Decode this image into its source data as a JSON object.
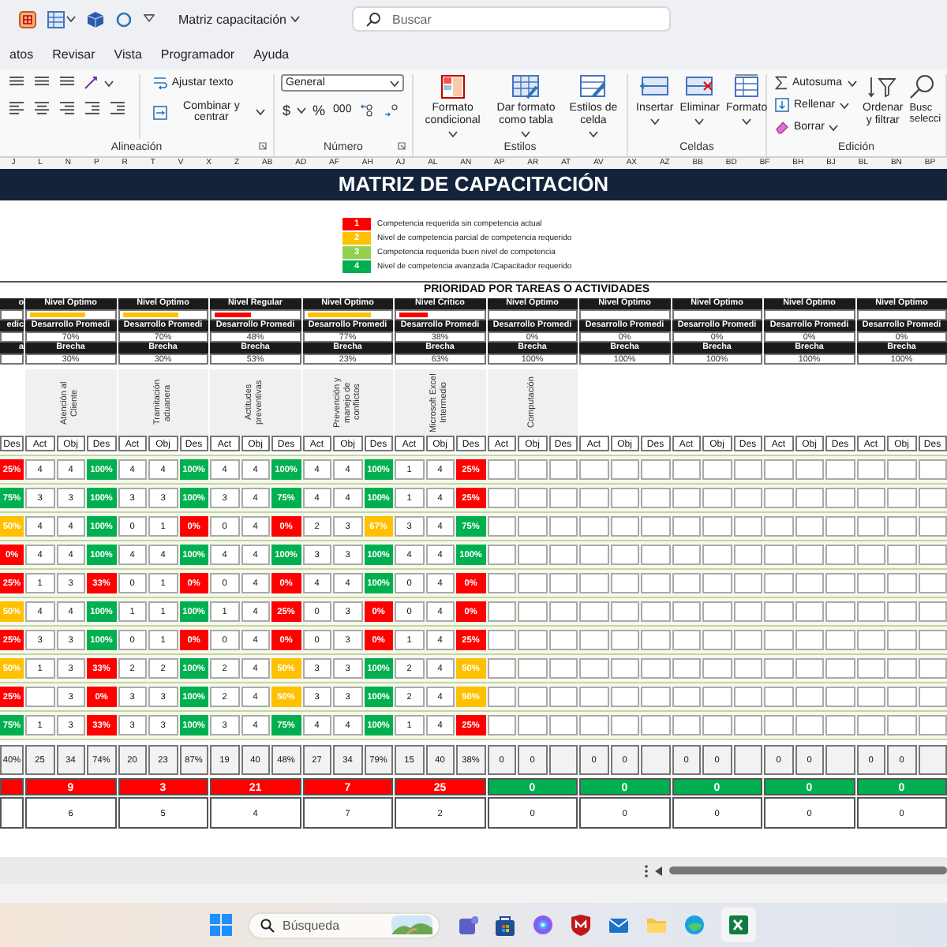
{
  "title_bar": {
    "document_title": "Matriz capacitación",
    "search_placeholder": "Buscar"
  },
  "menu_tabs": [
    "atos",
    "Revisar",
    "Vista",
    "Programador",
    "Ayuda"
  ],
  "ribbon": {
    "alignment": {
      "label": "Alineación",
      "wrap_text": "Ajustar texto",
      "merge_center": "Combinar y centrar"
    },
    "number": {
      "label": "Número",
      "format": "General",
      "currency": "$",
      "percent": "%",
      "thousands": "000"
    },
    "styles": {
      "label": "Estilos",
      "commands": [
        "Formato condicional",
        "Dar formato como tabla",
        "Estilos de celda"
      ]
    },
    "cells": {
      "label": "Celdas",
      "commands": [
        "Insertar",
        "Eliminar",
        "Formato"
      ]
    },
    "editing": {
      "label": "Edición",
      "autosum": "Autosuma",
      "fill": "Rellenar",
      "clear": "Borrar",
      "sort_filter": "Ordenar y filtrar",
      "find_select": "Busc selecci"
    }
  },
  "sheet": {
    "column_letters": [
      "J",
      "L",
      "N",
      "P",
      "R",
      "T",
      "V",
      "X",
      "Z",
      "AB",
      "AD",
      "AF",
      "AH",
      "AJ",
      "AL",
      "AN",
      "AP",
      "AR",
      "AT",
      "AV",
      "AX",
      "AZ",
      "BB",
      "BD",
      "BF",
      "BH",
      "BJ",
      "BL",
      "BN",
      "BP"
    ],
    "title": "MATRIZ DE CAPACITACIÓN",
    "legend": [
      {
        "value": "1",
        "text": "Competencia requerida sin competencia actual",
        "color": "#ff0000"
      },
      {
        "value": "2",
        "text": "Nivel de competencia parcial de competencia requerido",
        "color": "#ffc000"
      },
      {
        "value": "3",
        "text": "Competencia requerida buen nivel de competencia",
        "color": "#92d050"
      },
      {
        "value": "4",
        "text": "Nivel de competencia avanzada /Capacitador requerido",
        "color": "#00b050"
      }
    ],
    "priority_title": "PRIORIDAD POR TAREAS O ACTIVIDADES",
    "lead": {
      "level_name": "o",
      "development_label": "edic",
      "gap_label": "a",
      "column": "Des",
      "total": "40%",
      "priority": {
        "color": "#ff0000"
      }
    },
    "groups": [
      {
        "level_name": "Nivel Optimo",
        "bar": {
          "level": 0.68,
          "color": "#ffc000"
        },
        "development_label": "Desarrollo Promedi",
        "development": "70%",
        "gap_label": "Brecha",
        "gap": "30%",
        "skill": "Atención al Cliente",
        "columns": [
          "Act",
          "Obj",
          "Des"
        ],
        "total": {
          "act": "25",
          "obj": "34",
          "des": "74%"
        },
        "priority": {
          "value": "9",
          "color": "#ff0000"
        },
        "count": "6"
      },
      {
        "level_name": "Nivel Optimo",
        "bar": {
          "level": 0.68,
          "color": "#ffc000"
        },
        "development_label": "Desarrollo Promedi",
        "development": "70%",
        "gap_label": "Brecha",
        "gap": "30%",
        "skill": "Tramitación aduanera",
        "columns": [
          "Act",
          "Obj",
          "Des"
        ],
        "total": {
          "act": "20",
          "obj": "23",
          "des": "87%"
        },
        "priority": {
          "value": "3",
          "color": "#ff0000"
        },
        "count": "5"
      },
      {
        "level_name": "Nivel Regular",
        "bar": {
          "level": 0.45,
          "color": "#ff0000"
        },
        "development_label": "Desarrollo Promedi",
        "development": "48%",
        "gap_label": "Brecha",
        "gap": "53%",
        "skill": "Actitudes preventivas",
        "columns": [
          "Act",
          "Obj",
          "Des"
        ],
        "total": {
          "act": "19",
          "obj": "40",
          "des": "48%"
        },
        "priority": {
          "value": "21",
          "color": "#ff0000"
        },
        "count": "4"
      },
      {
        "level_name": "Nivel Optimo",
        "bar": {
          "level": 0.79,
          "color": "#ffc000"
        },
        "development_label": "Desarrollo Promedi",
        "development": "77%",
        "gap_label": "Brecha",
        "gap": "23%",
        "skill": "Prevención y manejo de conflictos",
        "columns": [
          "Act",
          "Obj",
          "Des"
        ],
        "total": {
          "act": "27",
          "obj": "34",
          "des": "79%"
        },
        "priority": {
          "value": "7",
          "color": "#ff0000"
        },
        "count": "7"
      },
      {
        "level_name": "Nivel Critico",
        "bar": {
          "level": 0.35,
          "color": "#ff0000"
        },
        "development_label": "Desarrollo Promedi",
        "development": "38%",
        "gap_label": "Brecha",
        "gap": "63%",
        "skill": "Microsoft Excel Intermedio",
        "columns": [
          "Act",
          "Obj",
          "Des"
        ],
        "total": {
          "act": "15",
          "obj": "40",
          "des": "38%"
        },
        "priority": {
          "value": "25",
          "color": "#ff0000"
        },
        "count": "2"
      },
      {
        "level_name": "Nivel Optimo",
        "development_label": "Desarrollo Promedi",
        "development": "0%",
        "gap_label": "Brecha",
        "gap": "100%",
        "skill": "Computación",
        "columns": [
          "Act",
          "Obj",
          "Des"
        ],
        "total": {
          "act": "0",
          "obj": "0"
        },
        "priority": {
          "value": "0",
          "color": "#00b050"
        },
        "count": "0"
      },
      {
        "level_name": "Nivel Optimo",
        "development_label": "Desarrollo Promedi",
        "development": "0%",
        "gap_label": "Brecha",
        "gap": "100%",
        "columns": [
          "Act",
          "Obj",
          "Des"
        ],
        "total": {
          "act": "0",
          "obj": "0"
        },
        "priority": {
          "value": "0",
          "color": "#00b050"
        },
        "count": "0"
      },
      {
        "level_name": "Nivel Optimo",
        "development_label": "Desarrollo Promedi",
        "development": "0%",
        "gap_label": "Brecha",
        "gap": "100%",
        "columns": [
          "Act",
          "Obj",
          "Des"
        ],
        "total": {
          "act": "0",
          "obj": "0"
        },
        "priority": {
          "value": "0",
          "color": "#00b050"
        },
        "count": "0"
      },
      {
        "level_name": "Nivel Optimo",
        "development_label": "Desarrollo Promedi",
        "development": "0%",
        "gap_label": "Brecha",
        "gap": "100%",
        "columns": [
          "Act",
          "Obj",
          "Des"
        ],
        "total": {
          "act": "0",
          "obj": "0"
        },
        "priority": {
          "value": "0",
          "color": "#00b050"
        },
        "count": "0"
      },
      {
        "level_name": "Nivel Optimo",
        "development_label": "Desarrollo Promedi",
        "development": "0%",
        "gap_label": "Brecha",
        "gap": "100%",
        "columns": [
          "Act",
          "Obj",
          "Des"
        ],
        "total": {
          "act": "0",
          "obj": "0"
        },
        "priority": {
          "value": "0",
          "color": "#00b050"
        },
        "count": "0"
      }
    ],
    "rows": [
      {
        "lead": {
          "text": "25%",
          "color": "#ff0000"
        },
        "cells": [
          {
            "act": "4",
            "obj": "4",
            "des": "100%",
            "color": "#00b050"
          },
          {
            "act": "4",
            "obj": "4",
            "des": "100%",
            "color": "#00b050"
          },
          {
            "act": "4",
            "obj": "4",
            "des": "100%",
            "color": "#00b050"
          },
          {
            "act": "4",
            "obj": "4",
            "des": "100%",
            "color": "#00b050"
          },
          {
            "act": "1",
            "obj": "4",
            "des": "25%",
            "color": "#ff0000"
          }
        ]
      },
      {
        "lead": {
          "text": "75%",
          "color": "#00b050"
        },
        "cells": [
          {
            "act": "3",
            "obj": "3",
            "des": "100%",
            "color": "#00b050"
          },
          {
            "act": "3",
            "obj": "3",
            "des": "100%",
            "color": "#00b050"
          },
          {
            "act": "3",
            "obj": "4",
            "des": "75%",
            "color": "#00b050"
          },
          {
            "act": "4",
            "obj": "4",
            "des": "100%",
            "color": "#00b050"
          },
          {
            "act": "1",
            "obj": "4",
            "des": "25%",
            "color": "#ff0000"
          }
        ]
      },
      {
        "lead": {
          "text": "50%",
          "color": "#ffc000"
        },
        "cells": [
          {
            "act": "4",
            "obj": "4",
            "des": "100%",
            "color": "#00b050"
          },
          {
            "act": "0",
            "obj": "1",
            "des": "0%",
            "color": "#ff0000"
          },
          {
            "act": "0",
            "obj": "4",
            "des": "0%",
            "color": "#ff0000"
          },
          {
            "act": "2",
            "obj": "3",
            "des": "67%",
            "color": "#ffc000"
          },
          {
            "act": "3",
            "obj": "4",
            "des": "75%",
            "color": "#00b050"
          }
        ]
      },
      {
        "lead": {
          "text": "0%",
          "color": "#ff0000"
        },
        "cells": [
          {
            "act": "4",
            "obj": "4",
            "des": "100%",
            "color": "#00b050"
          },
          {
            "act": "4",
            "obj": "4",
            "des": "100%",
            "color": "#00b050"
          },
          {
            "act": "4",
            "obj": "4",
            "des": "100%",
            "color": "#00b050"
          },
          {
            "act": "3",
            "obj": "3",
            "des": "100%",
            "color": "#00b050"
          },
          {
            "act": "4",
            "obj": "4",
            "des": "100%",
            "color": "#00b050"
          }
        ]
      },
      {
        "lead": {
          "text": "25%",
          "color": "#ff0000"
        },
        "cells": [
          {
            "act": "1",
            "obj": "3",
            "des": "33%",
            "color": "#ff0000"
          },
          {
            "act": "0",
            "obj": "1",
            "des": "0%",
            "color": "#ff0000"
          },
          {
            "act": "0",
            "obj": "4",
            "des": "0%",
            "color": "#ff0000"
          },
          {
            "act": "4",
            "obj": "4",
            "des": "100%",
            "color": "#00b050"
          },
          {
            "act": "0",
            "obj": "4",
            "des": "0%",
            "color": "#ff0000"
          }
        ]
      },
      {
        "lead": {
          "text": "50%",
          "color": "#ffc000"
        },
        "cells": [
          {
            "act": "4",
            "obj": "4",
            "des": "100%",
            "color": "#00b050"
          },
          {
            "act": "1",
            "obj": "1",
            "des": "100%",
            "color": "#00b050"
          },
          {
            "act": "1",
            "obj": "4",
            "des": "25%",
            "color": "#ff0000"
          },
          {
            "act": "0",
            "obj": "3",
            "des": "0%",
            "color": "#ff0000"
          },
          {
            "act": "0",
            "obj": "4",
            "des": "0%",
            "color": "#ff0000"
          }
        ]
      },
      {
        "lead": {
          "text": "25%",
          "color": "#ff0000"
        },
        "cells": [
          {
            "act": "3",
            "obj": "3",
            "des": "100%",
            "color": "#00b050"
          },
          {
            "act": "0",
            "obj": "1",
            "des": "0%",
            "color": "#ff0000"
          },
          {
            "act": "0",
            "obj": "4",
            "des": "0%",
            "color": "#ff0000"
          },
          {
            "act": "0",
            "obj": "3",
            "des": "0%",
            "color": "#ff0000"
          },
          {
            "act": "1",
            "obj": "4",
            "des": "25%",
            "color": "#ff0000"
          }
        ]
      },
      {
        "lead": {
          "text": "50%",
          "color": "#ffc000"
        },
        "cells": [
          {
            "act": "1",
            "obj": "3",
            "des": "33%",
            "color": "#ff0000"
          },
          {
            "act": "2",
            "obj": "2",
            "des": "100%",
            "color": "#00b050"
          },
          {
            "act": "2",
            "obj": "4",
            "des": "50%",
            "color": "#ffc000"
          },
          {
            "act": "3",
            "obj": "3",
            "des": "100%",
            "color": "#00b050"
          },
          {
            "act": "2",
            "obj": "4",
            "des": "50%",
            "color": "#ffc000"
          }
        ]
      },
      {
        "lead": {
          "text": "25%",
          "color": "#ff0000"
        },
        "cells": [
          {
            "obj": "3",
            "des": "0%",
            "color": "#ff0000"
          },
          {
            "act": "3",
            "obj": "3",
            "des": "100%",
            "color": "#00b050"
          },
          {
            "act": "2",
            "obj": "4",
            "des": "50%",
            "color": "#ffc000"
          },
          {
            "act": "3",
            "obj": "3",
            "des": "100%",
            "color": "#00b050"
          },
          {
            "act": "2",
            "obj": "4",
            "des": "50%",
            "color": "#ffc000"
          }
        ]
      },
      {
        "lead": {
          "text": "75%",
          "color": "#00b050"
        },
        "cells": [
          {
            "act": "1",
            "obj": "3",
            "des": "33%",
            "color": "#ff0000"
          },
          {
            "act": "3",
            "obj": "3",
            "des": "100%",
            "color": "#00b050"
          },
          {
            "act": "3",
            "obj": "4",
            "des": "75%",
            "color": "#00b050"
          },
          {
            "act": "4",
            "obj": "4",
            "des": "100%",
            "color": "#00b050"
          },
          {
            "act": "1",
            "obj": "4",
            "des": "25%",
            "color": "#ff0000"
          }
        ]
      }
    ]
  },
  "taskbar": {
    "search_placeholder": "Búsqueda"
  }
}
